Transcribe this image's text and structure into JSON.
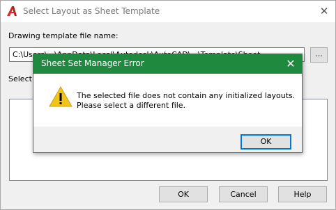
{
  "dialog": {
    "title": "Select Layout as Sheet Template",
    "close_glyph": "✕",
    "template_label": "Drawing template file name:",
    "template_path": "C:\\Users\\...\\AppData\\Local\\Autodesk\\AutoCAD\\...\\Template\\Sheet...",
    "browse_label": "...",
    "select_label": "Select a layout to create new sheets:",
    "buttons": {
      "ok": "OK",
      "cancel": "Cancel",
      "help": "Help"
    }
  },
  "error": {
    "title": "Sheet Set Manager Error",
    "close_glyph": "✕",
    "message_line1": "The selected file does not contain any initialized layouts.",
    "message_line2": "Please select a different file.",
    "ok_label": "OK"
  },
  "colors": {
    "error_titlebar": "#1f8a3e",
    "warning_icon": "#f2c318",
    "app_icon": "#d32b2b",
    "focus_border": "#0078d7"
  },
  "icons": {
    "app": "autocad-logo-icon",
    "warning": "warning-triangle-icon"
  }
}
